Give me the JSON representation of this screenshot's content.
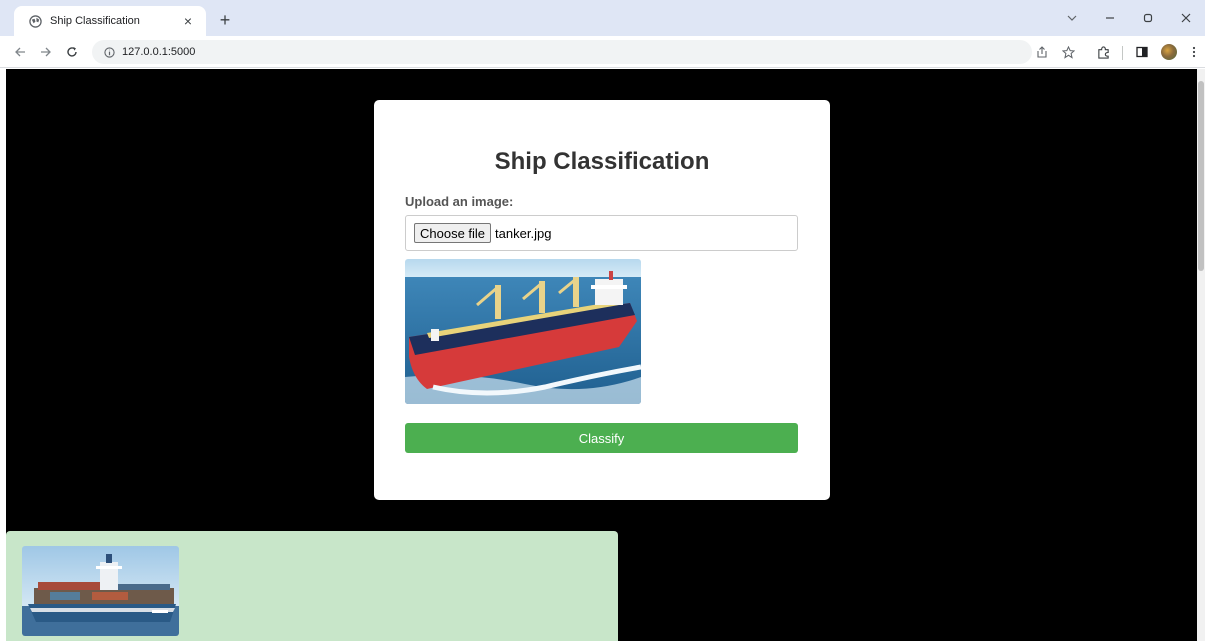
{
  "browser": {
    "tab_title": "Ship Classification",
    "tab_close": "×",
    "new_tab": "+",
    "url": "127.0.0.1:5000",
    "icons": [
      "globe-icon",
      "close-icon",
      "plus-icon",
      "chevron-down-icon",
      "minimize-icon",
      "restore-icon",
      "window-close-icon",
      "back-icon",
      "forward-icon",
      "reload-icon",
      "info-icon",
      "share-icon",
      "star-icon",
      "extensions-icon",
      "side-panel-icon",
      "profile-avatar",
      "menu-icon"
    ]
  },
  "page": {
    "title": "Ship Classification",
    "upload_label": "Upload an image:",
    "file_button": "Choose file",
    "file_name": "tanker.jpg",
    "classify_label": "Classify"
  },
  "colors": {
    "page_bg": "#000000",
    "card_bg": "#ffffff",
    "classify_button": "#4caf50",
    "result_panel": "#c8e6c9",
    "tabbar_bg": "#dfe6f5"
  }
}
